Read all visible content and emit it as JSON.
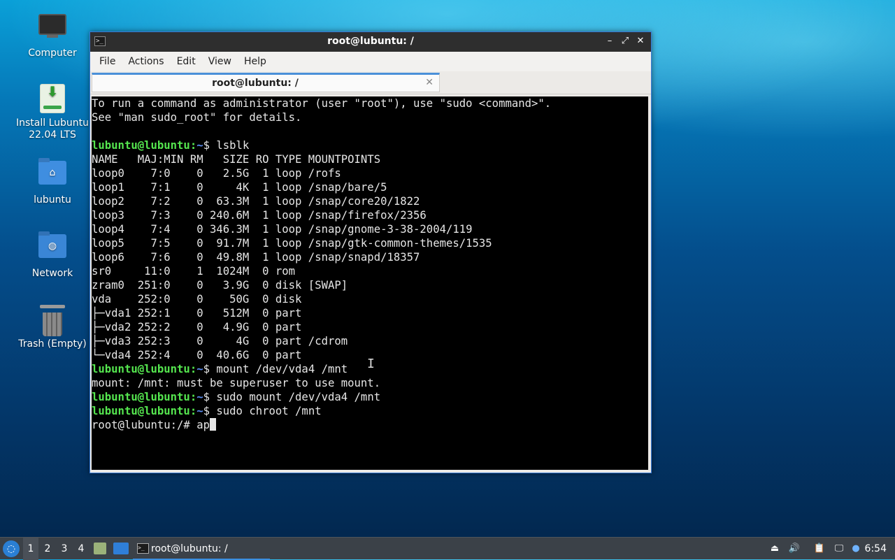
{
  "desktop": {
    "icons": [
      {
        "label": "Computer"
      },
      {
        "label": "Install Lubuntu\n22.04 LTS"
      },
      {
        "label": "lubuntu"
      },
      {
        "label": "Network"
      },
      {
        "label": "Trash (Empty)"
      }
    ]
  },
  "window": {
    "title": "root@lubuntu: /",
    "menu": [
      "File",
      "Actions",
      "Edit",
      "View",
      "Help"
    ],
    "tab_label": "root@lubuntu: /",
    "buttons": {
      "minimize": "–",
      "maximize": "⤢",
      "close": "✕"
    }
  },
  "terminal": {
    "lines": [
      {
        "text": "To run a command as administrator (user \"root\"), use \"sudo <command>\"."
      },
      {
        "text": "See \"man sudo_root\" for details."
      },
      {
        "text": ""
      },
      {
        "user": "lubuntu@lubuntu",
        "path": "~",
        "cmd": "$ lsblk"
      },
      {
        "text": "NAME   MAJ:MIN RM   SIZE RO TYPE MOUNTPOINTS"
      },
      {
        "text": "loop0    7:0    0   2.5G  1 loop /rofs"
      },
      {
        "text": "loop1    7:1    0     4K  1 loop /snap/bare/5"
      },
      {
        "text": "loop2    7:2    0  63.3M  1 loop /snap/core20/1822"
      },
      {
        "text": "loop3    7:3    0 240.6M  1 loop /snap/firefox/2356"
      },
      {
        "text": "loop4    7:4    0 346.3M  1 loop /snap/gnome-3-38-2004/119"
      },
      {
        "text": "loop5    7:5    0  91.7M  1 loop /snap/gtk-common-themes/1535"
      },
      {
        "text": "loop6    7:6    0  49.8M  1 loop /snap/snapd/18357"
      },
      {
        "text": "sr0     11:0    1  1024M  0 rom"
      },
      {
        "text": "zram0  251:0    0   3.9G  0 disk [SWAP]"
      },
      {
        "text": "vda    252:0    0    50G  0 disk"
      },
      {
        "text": "├─vda1 252:1    0   512M  0 part"
      },
      {
        "text": "├─vda2 252:2    0   4.9G  0 part"
      },
      {
        "text": "├─vda3 252:3    0     4G  0 part /cdrom"
      },
      {
        "text": "└─vda4 252:4    0  40.6G  0 part"
      },
      {
        "user": "lubuntu@lubuntu",
        "path": "~",
        "cmd": "$ mount /dev/vda4 /mnt"
      },
      {
        "text": "mount: /mnt: must be superuser to use mount."
      },
      {
        "user": "lubuntu@lubuntu",
        "path": "~",
        "cmd": "$ sudo mount /dev/vda4 /mnt"
      },
      {
        "user": "lubuntu@lubuntu",
        "path": "~",
        "cmd": "$ sudo chroot /mnt"
      },
      {
        "text": "root@lubuntu:/# ap",
        "cursor": true
      }
    ]
  },
  "taskbar": {
    "desktops": [
      "1",
      "2",
      "3",
      "4"
    ],
    "active_desktop": "1",
    "task_label": "root@lubuntu: /",
    "clock": "6:54"
  },
  "colors": {
    "prompt_user": "#55e64f",
    "prompt_path": "#5a8cf0",
    "accent": "#3b8fe0"
  }
}
